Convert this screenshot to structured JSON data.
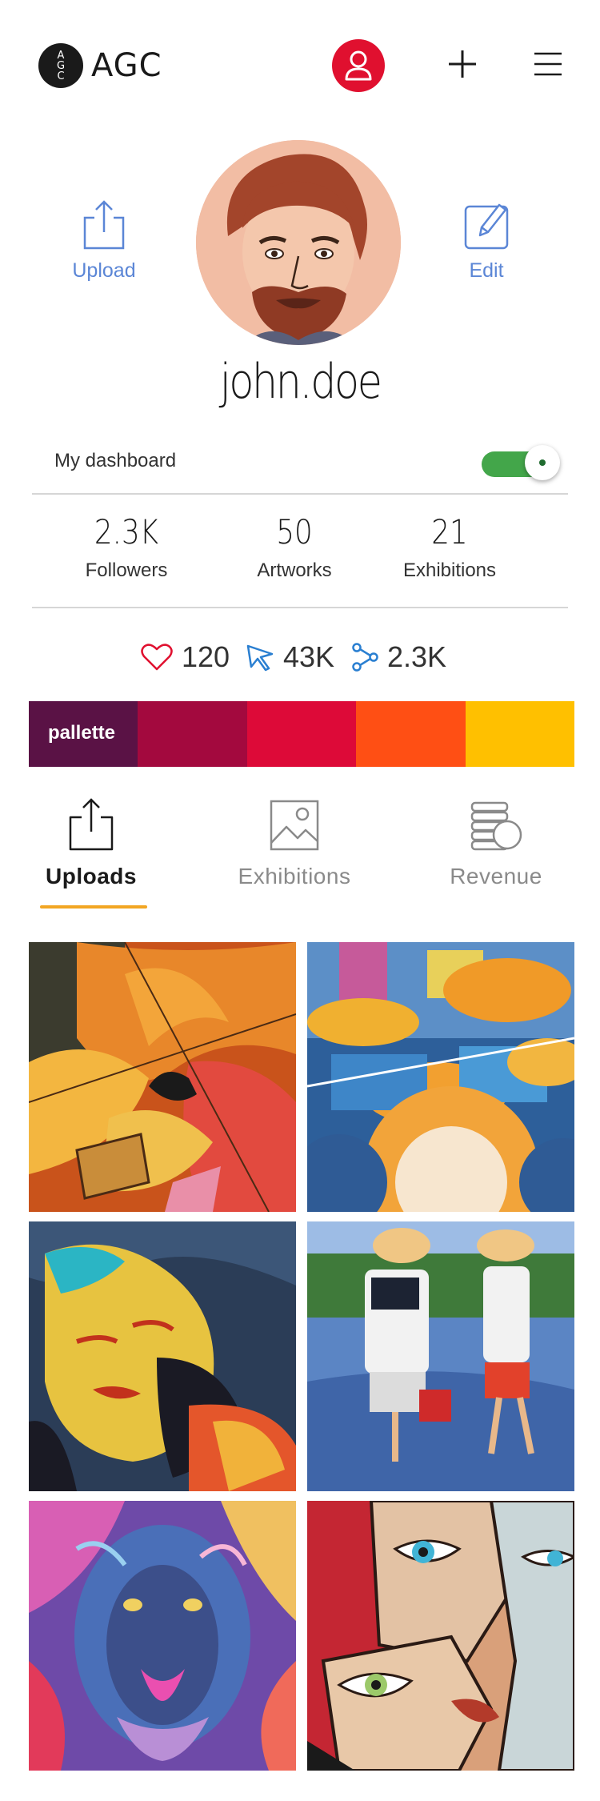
{
  "header": {
    "logo_letters": [
      "A",
      "G",
      "C"
    ],
    "logo_text": "AGC"
  },
  "profile": {
    "username": "john.doe",
    "upload_label": "Upload",
    "edit_label": "Edit",
    "dashboard_label": "My dashboard",
    "dashboard_enabled": true
  },
  "stats": [
    {
      "value": "2.3K",
      "label": "Followers"
    },
    {
      "value": "50",
      "label": "Artworks"
    },
    {
      "value": "21",
      "label": "Exhibitions"
    }
  ],
  "metrics": {
    "likes": "120",
    "views": "43K",
    "shares": "2.3K"
  },
  "palette": {
    "label": "pallette",
    "colors": [
      "#5a1245",
      "#a3093e",
      "#dd0a38",
      "#ff4f14",
      "#ffc000"
    ]
  },
  "tabs": [
    {
      "label": "Uploads",
      "active": true
    },
    {
      "label": "Exhibitions",
      "active": false
    },
    {
      "label": "Revenue",
      "active": false
    }
  ],
  "accent_colors": {
    "brand_red": "#e0102f",
    "toggle_green": "#43a64a",
    "action_blue": "#5b86d6",
    "tab_underline": "#f2a623"
  }
}
